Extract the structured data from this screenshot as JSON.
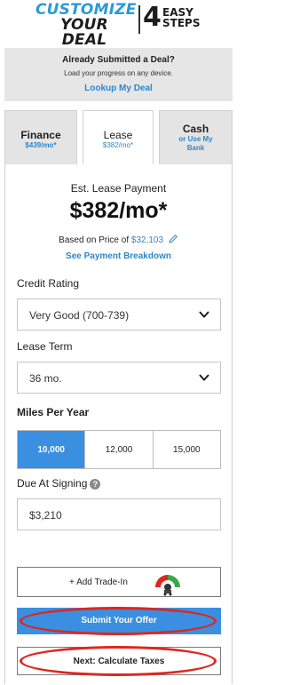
{
  "header": {
    "logo_line1": "CUSTOMIZE",
    "logo_line2": "YOUR DEAL",
    "logo_number": "4",
    "logo_steps_line1": "EASY",
    "logo_steps_line2": "STEPS"
  },
  "submitted": {
    "title": "Already Submitted a Deal?",
    "subtitle": "Load your progress on any device.",
    "link": "Lookup My Deal"
  },
  "tabs": [
    {
      "name": "Finance",
      "sub": "$439/mo*",
      "active": false
    },
    {
      "name": "Lease",
      "sub": "$382/mo*",
      "active": true
    },
    {
      "name": "Cash",
      "sub": "or Use My Bank",
      "active": false
    }
  ],
  "estimate": {
    "label": "Est. Lease Payment",
    "payment": "$382/mo*",
    "based_prefix": "Based on Price of ",
    "price": "$32,103",
    "breakdown_link": "See Payment Breakdown"
  },
  "credit": {
    "label": "Credit Rating",
    "value": "Very Good (700-739)"
  },
  "lease_term": {
    "label": "Lease Term",
    "value": "36 mo."
  },
  "miles": {
    "label": "Miles Per Year",
    "options": [
      "10,000",
      "12,000",
      "15,000"
    ],
    "selected": "10,000"
  },
  "due": {
    "label": "Due At Signing",
    "value": "$3,210"
  },
  "buttons": {
    "trade_in": "+ Add Trade-In",
    "submit": "Submit Your Offer",
    "next": "Next: Calculate Taxes"
  },
  "colors": {
    "accent_blue": "#3a8fe0",
    "link_blue": "#2f86c8",
    "annotation_red": "#e0261e"
  }
}
